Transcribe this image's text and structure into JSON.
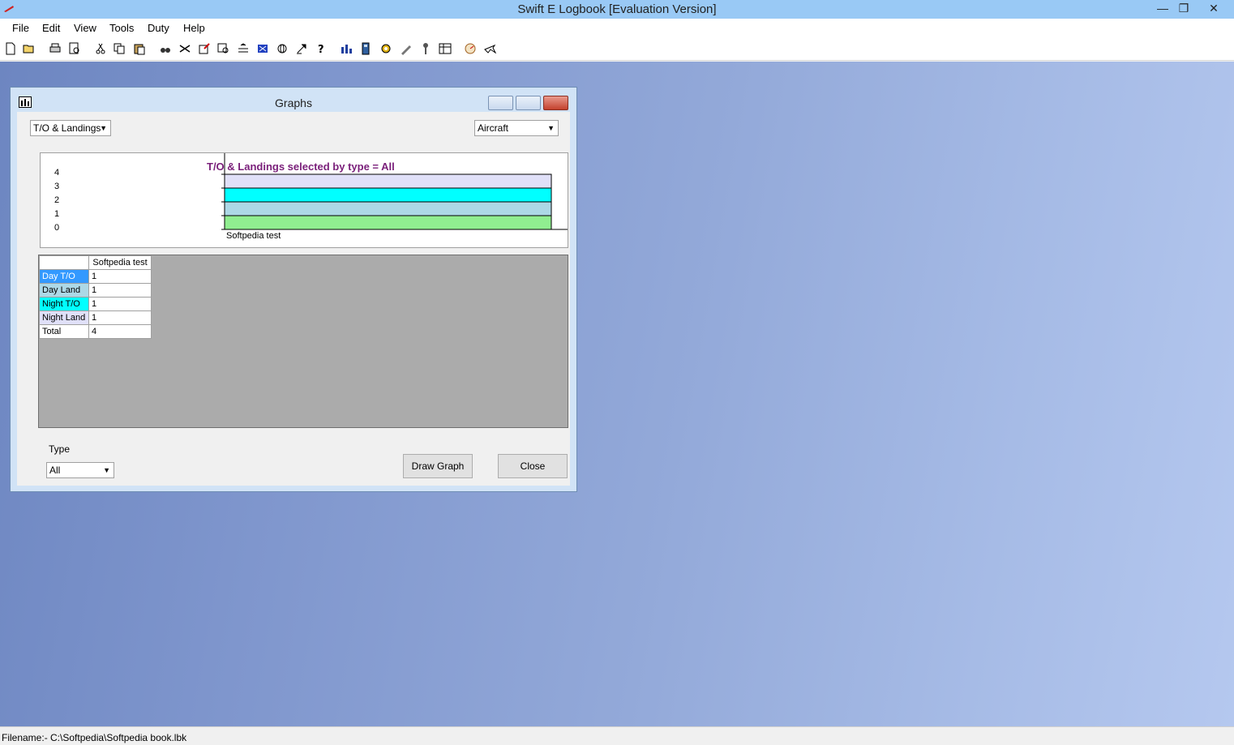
{
  "app": {
    "title": "Swift E Logbook [Evaluation Version]",
    "minimize_glyph": "—",
    "restore_glyph": "❐",
    "close_glyph": "✕"
  },
  "menu": {
    "items": [
      "File",
      "Edit",
      "View",
      "Tools",
      "Duty",
      "Help"
    ]
  },
  "toolbar": {
    "icons": [
      "new-file-icon",
      "open-folder-icon",
      "print-icon",
      "print-preview-icon",
      "cut-icon",
      "copy-icon",
      "paste-icon",
      "binoculars-icon",
      "scissors-icon",
      "edit-record-icon",
      "find-icon",
      "rows-icon",
      "filter-icon",
      "globe-icon",
      "expand-icon",
      "help-icon",
      "bar-chart-icon",
      "calculator-icon",
      "settings-icon",
      "edit-pen-icon",
      "key-icon",
      "table-icon",
      "gauge-icon",
      "plane-icon"
    ]
  },
  "graphs_window": {
    "title": "Graphs",
    "category_select": "T/O & Landings",
    "group_select": "Aircraft",
    "type_label": "Type",
    "type_select": "All",
    "draw_button": "Draw Graph",
    "close_button": "Close"
  },
  "chart_data": {
    "type": "bar",
    "stacked": true,
    "title": "T/O & Landings selected by type = All",
    "categories": [
      "Softpedia test"
    ],
    "series": [
      {
        "name": "Day T/O",
        "values": [
          1
        ],
        "color": "#e0e0f8"
      },
      {
        "name": "Day Land",
        "values": [
          1
        ],
        "color": "#00ffff"
      },
      {
        "name": "Night T/O",
        "values": [
          1
        ],
        "color": "#add8e6"
      },
      {
        "name": "Night Land",
        "values": [
          1
        ],
        "color": "#90ee90"
      }
    ],
    "yticks": [
      "4",
      "3",
      "2",
      "1",
      "0"
    ],
    "ylim": [
      0,
      4
    ]
  },
  "table": {
    "column_header": "Softpedia test",
    "rows": [
      {
        "label": "Day T/O",
        "value": "1",
        "color": "#3399ff"
      },
      {
        "label": "Day Land",
        "value": "1",
        "color": "#add8e6"
      },
      {
        "label": "Night T/O",
        "value": "1",
        "color": "#00ffff"
      },
      {
        "label": "Night Land",
        "value": "1",
        "color": "#e0e0f8"
      },
      {
        "label": "Total",
        "value": "4",
        "color": "#ffffff"
      }
    ]
  },
  "status": {
    "filename": "Filename:- C:\\Softpedia\\Softpedia book.lbk"
  }
}
